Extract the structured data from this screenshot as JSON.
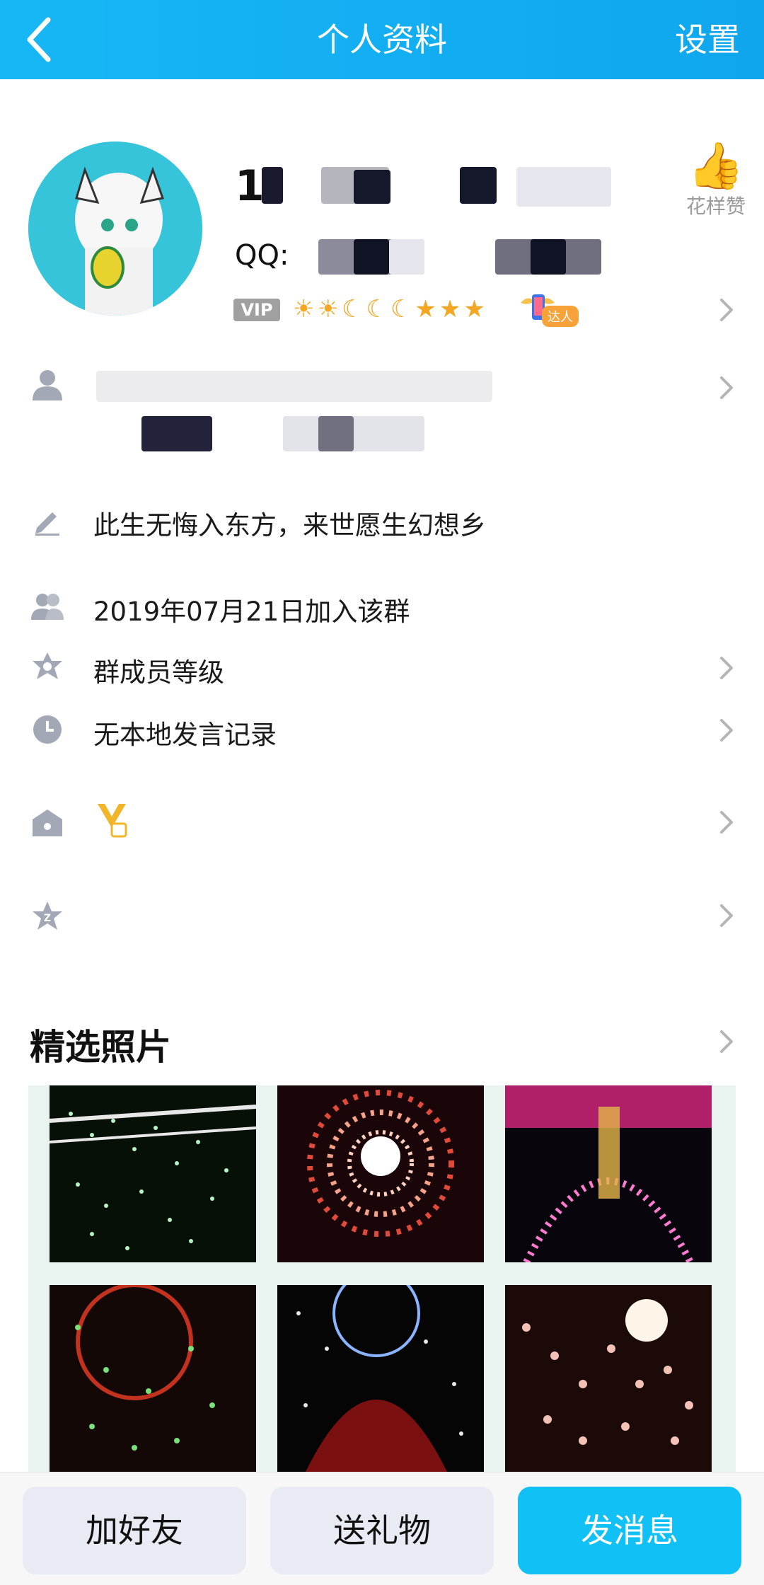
{
  "topbar": {
    "title": "个人资料",
    "settings": "设置"
  },
  "profile": {
    "name_visible": "1",
    "qq_label": "QQ:",
    "vip_badge": "VIP",
    "level_icons": [
      "sun",
      "sun",
      "moon",
      "moon",
      "moon",
      "star",
      "star",
      "star"
    ],
    "daren_label": "达人",
    "like_label": "花样赞"
  },
  "rows": {
    "signature": "此生无悔入东方，来世愿生幻想乡",
    "join_date": "2019年07月21日加入该群",
    "member_level": "群成员等级",
    "speech_record": "无本地发言记录"
  },
  "photos_section": {
    "title": "精选照片"
  },
  "bottom": {
    "add_friend": "加好友",
    "send_gift": "送礼物",
    "send_message": "发消息"
  },
  "colors": {
    "topbar": "#17b7f5",
    "primary_button": "#11c0f5",
    "secondary_button": "#e8ebf3",
    "icon_gray": "#a3a8b6"
  }
}
